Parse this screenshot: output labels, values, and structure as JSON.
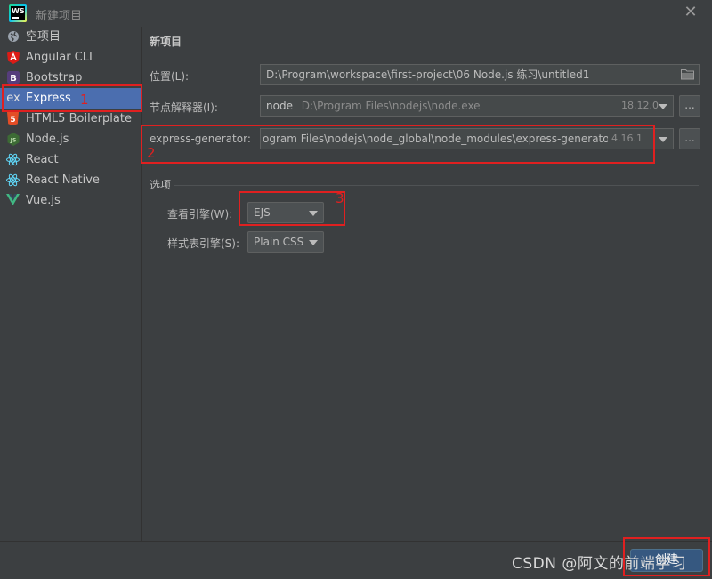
{
  "window": {
    "title": "新建项目",
    "app_icon": "webstorm-logo",
    "close_icon": "close-icon"
  },
  "sidebar": {
    "items": [
      {
        "label": "空项目",
        "icon": "globe-icon",
        "color": "#9aa3ad"
      },
      {
        "label": "Angular CLI",
        "icon": "angular-icon",
        "color": "#dd1b16"
      },
      {
        "label": "Bootstrap",
        "icon": "bootstrap-icon",
        "color": "#563d7c"
      },
      {
        "label": "Express",
        "icon": "express-icon",
        "color": "#c6c6c6",
        "selected": true
      },
      {
        "label": "HTML5 Boilerplate",
        "icon": "html5-icon",
        "color": "#e44d26"
      },
      {
        "label": "Node.js",
        "icon": "nodejs-icon",
        "color": "#5fa04e"
      },
      {
        "label": "React",
        "icon": "react-icon",
        "color": "#61dafb"
      },
      {
        "label": "React Native",
        "icon": "react-native-icon",
        "color": "#61dafb"
      },
      {
        "label": "Vue.js",
        "icon": "vue-icon",
        "color": "#41b883"
      }
    ]
  },
  "form": {
    "heading": "新项目",
    "location": {
      "label": "位置(L):",
      "value": "D:\\Program\\workspace\\first-project\\06 Node.js 练习\\untitled1"
    },
    "interpreter": {
      "label": "节点解释器(I):",
      "name": "node",
      "path": "D:\\Program Files\\nodejs\\node.exe",
      "version": "18.12.0",
      "browse": "..."
    },
    "generator": {
      "label": "express-generator:",
      "value": "ogram Files\\nodejs\\node_global\\node_modules\\express-generator",
      "version": "4.16.1",
      "browse": "..."
    },
    "options": {
      "section": "选项",
      "view_engine": {
        "label": "查看引擎(W):",
        "value": "EJS"
      },
      "css_engine": {
        "label": "样式表引擎(S):",
        "value": "Plain CSS"
      }
    }
  },
  "footer": {
    "create_label": "创建"
  },
  "annotations": {
    "n1": "1",
    "n2": "2",
    "n3": "3",
    "color": "#e02020"
  },
  "watermark": "CSDN @阿文的前端学习"
}
